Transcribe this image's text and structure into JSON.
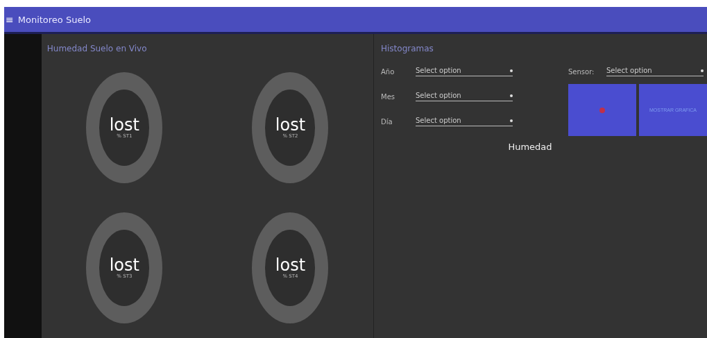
{
  "app_bar": {
    "menu_icon": "≡",
    "title": "Monitoreo Suelo"
  },
  "live_panel": {
    "title": "Humedad Suelo en Vivo",
    "gauges": [
      {
        "value": "lost",
        "label": "% ST1"
      },
      {
        "value": "lost",
        "label": "% ST2"
      },
      {
        "value": "lost",
        "label": "% ST3"
      },
      {
        "value": "lost",
        "label": "% ST4"
      }
    ]
  },
  "histogram_panel": {
    "title": "Histogramas",
    "selects": [
      {
        "label": "Año",
        "placeholder": "Select option"
      },
      {
        "label": "Mes",
        "placeholder": "Select option"
      },
      {
        "label": "Día",
        "placeholder": "Select option"
      }
    ],
    "sensor_select": {
      "label": "Sensor:",
      "placeholder": "Select option"
    },
    "buttons": [
      {
        "kind": "icon"
      },
      {
        "kind": "text",
        "label": "MOSTRAR GRAFICA"
      }
    ],
    "chart_title": "Humedad"
  }
}
